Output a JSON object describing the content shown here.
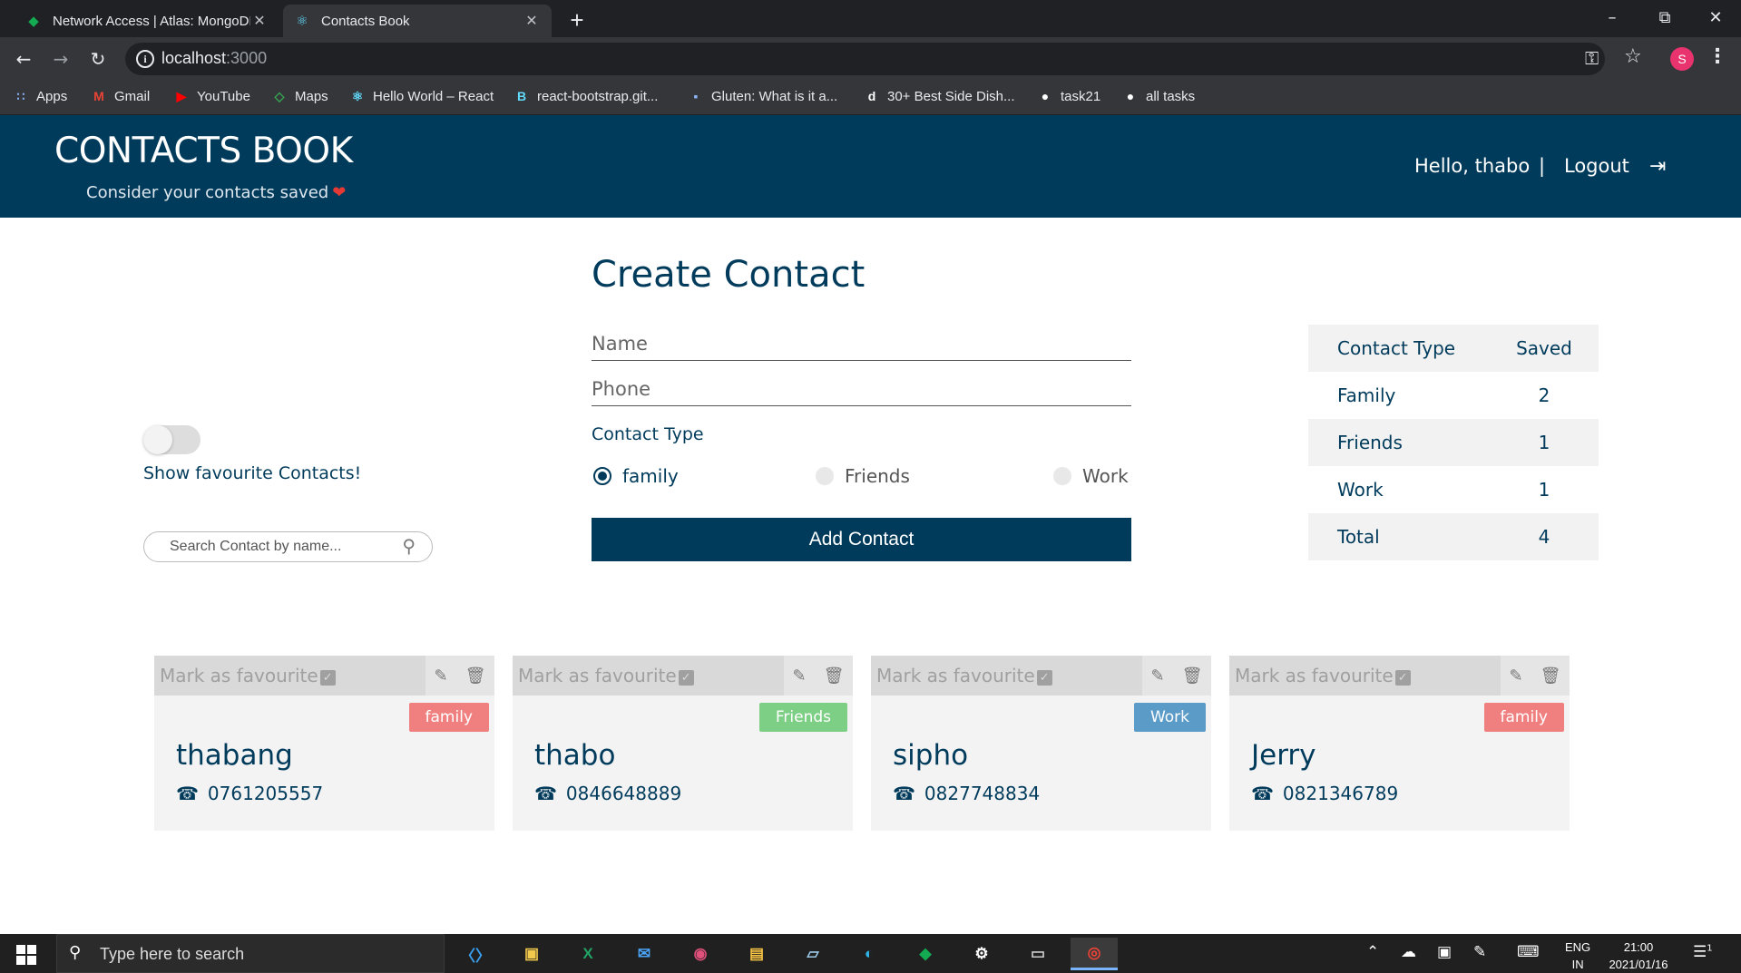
{
  "browser": {
    "tabs": [
      {
        "title": "Network Access | Atlas: MongoDB",
        "icon": "mongodb-leaf-icon",
        "active": false
      },
      {
        "title": "Contacts Book",
        "icon": "react-icon",
        "active": true
      }
    ],
    "url_host": "localhost",
    "url_port": ":3000",
    "profile_initial": "S",
    "bookmarks": [
      {
        "label": "Apps",
        "icon": "apps-grid-icon"
      },
      {
        "label": "Gmail",
        "icon": "gmail-icon"
      },
      {
        "label": "YouTube",
        "icon": "youtube-icon"
      },
      {
        "label": "Maps",
        "icon": "maps-icon"
      },
      {
        "label": "Hello World – React",
        "icon": "react-icon"
      },
      {
        "label": "react-bootstrap.git...",
        "icon": "react-bootstrap-icon"
      },
      {
        "label": "Gluten: What is it a...",
        "icon": "gluten-site-icon"
      },
      {
        "label": "30+ Best Side Dish...",
        "icon": "delish-icon"
      },
      {
        "label": "task21",
        "icon": "github-icon"
      },
      {
        "label": "all tasks",
        "icon": "github-icon"
      }
    ]
  },
  "header": {
    "brand": "CONTACTS BOOK",
    "tagline": "Consider your contacts saved",
    "greeting": "Hello, thabo",
    "separator": "|",
    "logout": "Logout",
    "colors": {
      "bar": "#003b5c",
      "heart": "#e53935"
    }
  },
  "sidebar": {
    "favourite_toggle_label": "Show favourite Contacts!",
    "favourite_toggle_on": false,
    "search_placeholder": "Search Contact by name..."
  },
  "form": {
    "title": "Create Contact",
    "name_placeholder": "Name",
    "phone_placeholder": "Phone",
    "contact_type_label": "Contact Type",
    "options": [
      {
        "label": "family",
        "checked": true
      },
      {
        "label": "Friends",
        "checked": false
      },
      {
        "label": "Work",
        "checked": false
      }
    ],
    "submit_label": "Add Contact"
  },
  "stats": {
    "headers": [
      "Contact Type",
      "Saved"
    ],
    "rows": [
      {
        "type": "Family",
        "count": "2"
      },
      {
        "type": "Friends",
        "count": "1"
      },
      {
        "type": "Work",
        "count": "1"
      },
      {
        "type": "Total",
        "count": "4"
      }
    ]
  },
  "contacts": [
    {
      "fav_label": "Mark as favourite",
      "badge": "family",
      "badge_color": "#f08080",
      "name": "thabang",
      "phone": "0761205557"
    },
    {
      "fav_label": "Mark as favourite",
      "badge": "Friends",
      "badge_color": "#7dcf85",
      "name": "thabo",
      "phone": "0846648889"
    },
    {
      "fav_label": "Mark as favourite",
      "badge": "Work",
      "badge_color": "#5b9bc8",
      "name": "sipho",
      "phone": "0827748834"
    },
    {
      "fav_label": "Mark as favourite",
      "badge": "family",
      "badge_color": "#f08080",
      "name": "Jerry",
      "phone": "0821346789"
    }
  ],
  "taskbar": {
    "search_placeholder": "Type here to search",
    "apps": [
      "vscode-icon",
      "store-icon",
      "excel-icon",
      "mail-icon",
      "media-icon",
      "file-explorer-icon",
      "notes-icon",
      "edge-icon",
      "mongodb-compass-icon",
      "settings-icon",
      "terminal-icon",
      "chrome-icon"
    ],
    "lang_line1": "ENG",
    "lang_line2": "IN",
    "time": "21:00",
    "date": "2021/01/16",
    "notification_count": "1"
  }
}
